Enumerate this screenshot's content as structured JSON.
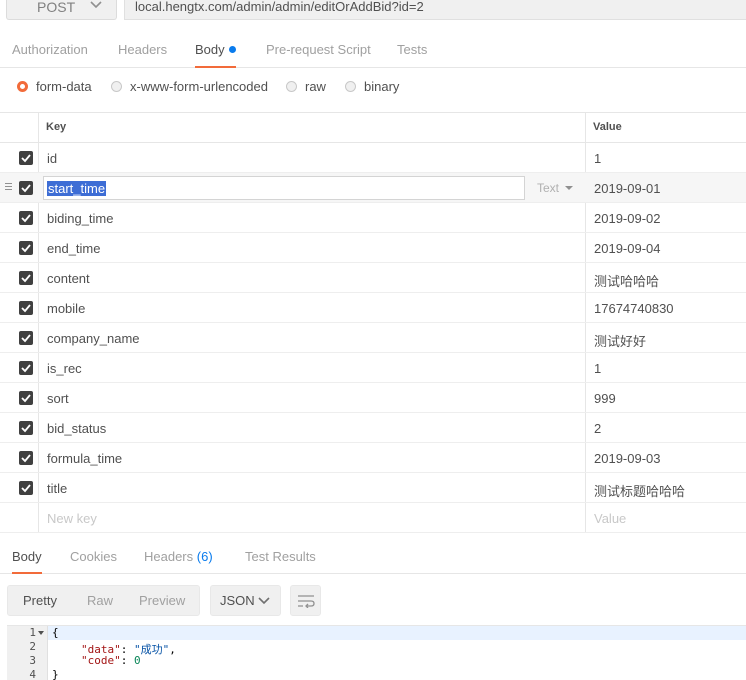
{
  "request": {
    "method": "POST",
    "url": "local.hengtx.com/admin/admin/editOrAddBid?id=2"
  },
  "request_tabs": [
    {
      "label": "Authorization",
      "active": false
    },
    {
      "label": "Headers",
      "active": false
    },
    {
      "label": "Body",
      "active": true,
      "modified": true
    },
    {
      "label": "Pre-request Script",
      "active": false
    },
    {
      "label": "Tests",
      "active": false
    }
  ],
  "body_types": [
    {
      "label": "form-data",
      "selected": true
    },
    {
      "label": "x-www-form-urlencoded",
      "selected": false
    },
    {
      "label": "raw",
      "selected": false
    },
    {
      "label": "binary",
      "selected": false
    }
  ],
  "table": {
    "key_header": "Key",
    "value_header": "Value",
    "rows": [
      {
        "key": "id",
        "value": "1",
        "checked": true
      },
      {
        "key": "start_time",
        "value": "2019-09-01",
        "checked": true,
        "editing": true,
        "type_label": "Text"
      },
      {
        "key": "biding_time",
        "value": "2019-09-02",
        "checked": true
      },
      {
        "key": "end_time",
        "value": "2019-09-04",
        "checked": true
      },
      {
        "key": "content",
        "value": "测试哈哈哈",
        "checked": true
      },
      {
        "key": "mobile",
        "value": "17674740830",
        "checked": true
      },
      {
        "key": "company_name",
        "value": "测试好好",
        "checked": true
      },
      {
        "key": "is_rec",
        "value": "1",
        "checked": true
      },
      {
        "key": "sort",
        "value": "999",
        "checked": true
      },
      {
        "key": "bid_status",
        "value": "2",
        "checked": true
      },
      {
        "key": "formula_time",
        "value": "2019-09-03",
        "checked": true
      },
      {
        "key": "title",
        "value": "测试标题哈哈哈",
        "checked": true
      }
    ],
    "new_key_placeholder": "New key",
    "new_value_placeholder": "Value"
  },
  "response_tabs": [
    {
      "label": "Body",
      "active": true
    },
    {
      "label": "Cookies",
      "active": false
    },
    {
      "label": "Headers",
      "count": "(6)",
      "active": false
    },
    {
      "label": "Test Results",
      "active": false
    }
  ],
  "response_view": {
    "modes": [
      "Pretty",
      "Raw",
      "Preview"
    ],
    "active_mode": "Pretty",
    "format": "JSON",
    "wrap_icon": "wrap-lines-icon"
  },
  "response_body": {
    "line_numbers": [
      "1",
      "2",
      "3",
      "4"
    ],
    "open_brace": "{",
    "close_brace": "}",
    "data_key": "\"data\"",
    "data_value": "\"成功\"",
    "code_key": "\"code\"",
    "code_value": "0"
  },
  "colors": {
    "accent": "#f26b3a",
    "link_blue": "#097bed",
    "selection": "#3d6dd5",
    "checkbox": "#404040"
  }
}
